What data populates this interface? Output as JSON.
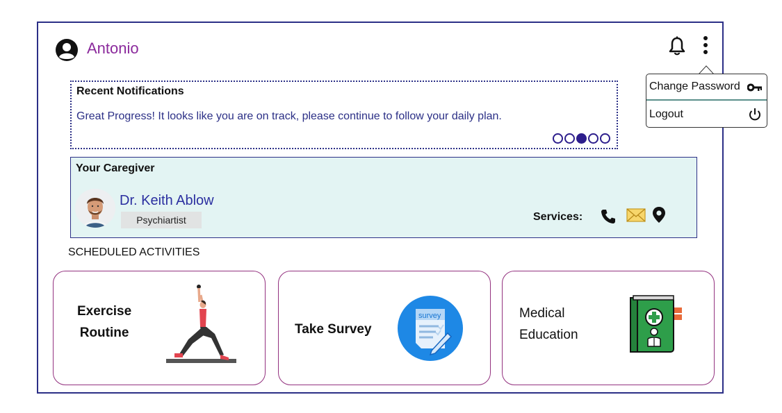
{
  "header": {
    "user_name": "Antonio",
    "icons": [
      "user-circle-icon",
      "bell-icon",
      "more-vertical-icon"
    ]
  },
  "menu": {
    "items": [
      {
        "label": "Change Password",
        "icon": "key-icon"
      },
      {
        "label": "Logout",
        "icon": "power-icon"
      }
    ]
  },
  "notifications": {
    "title": "Recent Notifications",
    "message": "Great Progress! It looks like you are on track, please continue to follow your daily plan.",
    "pager": {
      "total": 5,
      "active_index": 2
    }
  },
  "caregiver": {
    "title": "Your Caregiver",
    "name": "Dr. Keith Ablow",
    "role": "Psychiartist",
    "services_label": "Services:",
    "service_icons": [
      "phone-icon",
      "mail-icon",
      "map-pin-icon"
    ]
  },
  "scheduled": {
    "title": "SCHEDULED ACTIVITIES",
    "cards": [
      {
        "line1": "Exercise",
        "line2": "Routine",
        "icon": "exercise-illustration"
      },
      {
        "line1": "Take Survey",
        "line2": "",
        "icon": "survey-icon",
        "icon_text": "survey"
      },
      {
        "line1": "Medical",
        "line2": "Education",
        "icon": "medical-book-icon"
      }
    ]
  },
  "colors": {
    "frame": "#2b2f86",
    "username": "#8b2a9c",
    "caregiver_bg": "#e3f4f3",
    "card_border": "#93317f",
    "survey_blue": "#1e88e5",
    "book_green": "#2e9e4a"
  }
}
